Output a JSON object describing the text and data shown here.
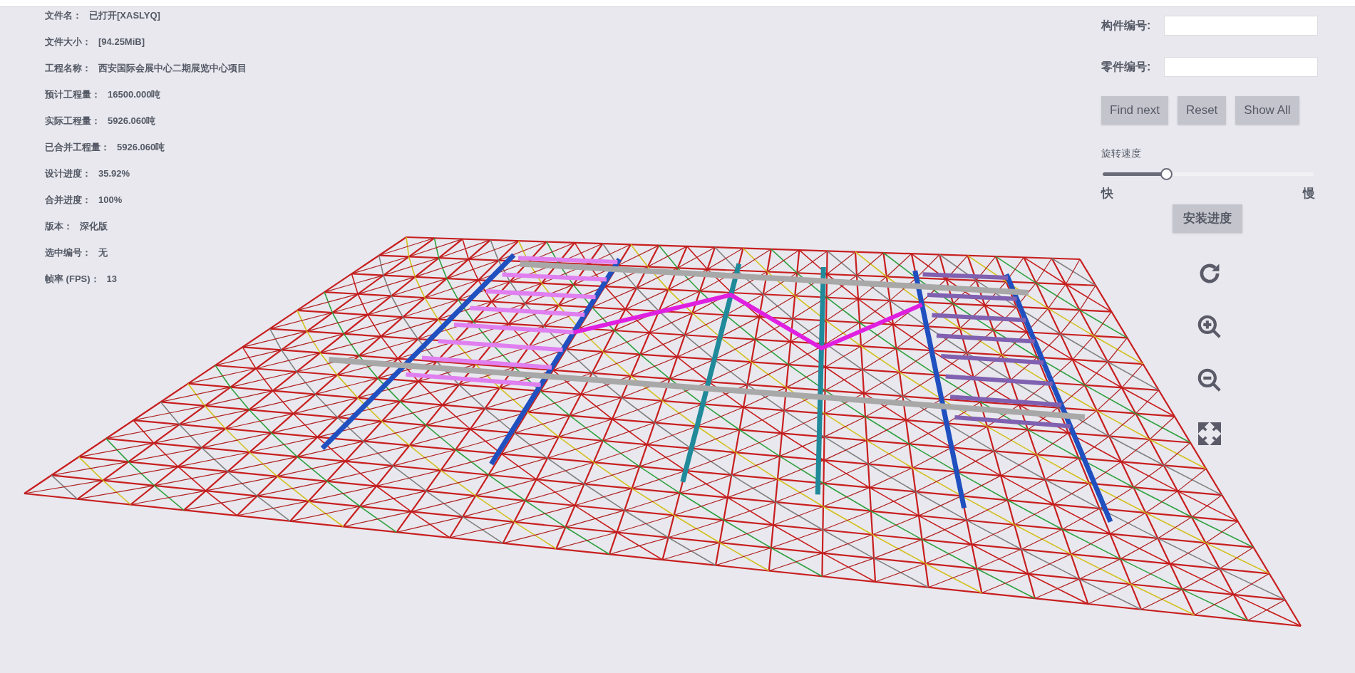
{
  "info": [
    {
      "label": "文件名：",
      "value": "已打开[XASLYQ]"
    },
    {
      "label": "文件大小：",
      "value": "[94.25MiB]"
    },
    {
      "label": "工程名称：",
      "value": "西安国际会展中心二期展览中心项目"
    },
    {
      "label": "预计工程量：",
      "value": "16500.000吨"
    },
    {
      "label": "实际工程量：",
      "value": "5926.060吨"
    },
    {
      "label": "已合并工程量：",
      "value": "5926.060吨"
    },
    {
      "label": "设计进度：",
      "value": "35.92%"
    },
    {
      "label": "合并进度：",
      "value": "100%"
    },
    {
      "label": "版本：",
      "value": "深化版"
    },
    {
      "label": "选中编号：",
      "value": "无"
    },
    {
      "label": "帧率 (FPS)：",
      "value": "13"
    }
  ],
  "search_fields": [
    {
      "label": "构件编号:"
    },
    {
      "label": "零件编号:"
    }
  ],
  "buttons": [
    "Find next",
    "Reset",
    "Show All"
  ],
  "rotation_speed": {
    "label": "旋转速度",
    "level": 0.3,
    "min_label": "快",
    "max_label": "慢"
  },
  "progress_button": "安装进度",
  "view_tools": [
    {
      "kind": "rotate"
    },
    {
      "kind": "zoom_in"
    },
    {
      "kind": "zoom_out"
    },
    {
      "kind": "fullscreen"
    }
  ]
}
